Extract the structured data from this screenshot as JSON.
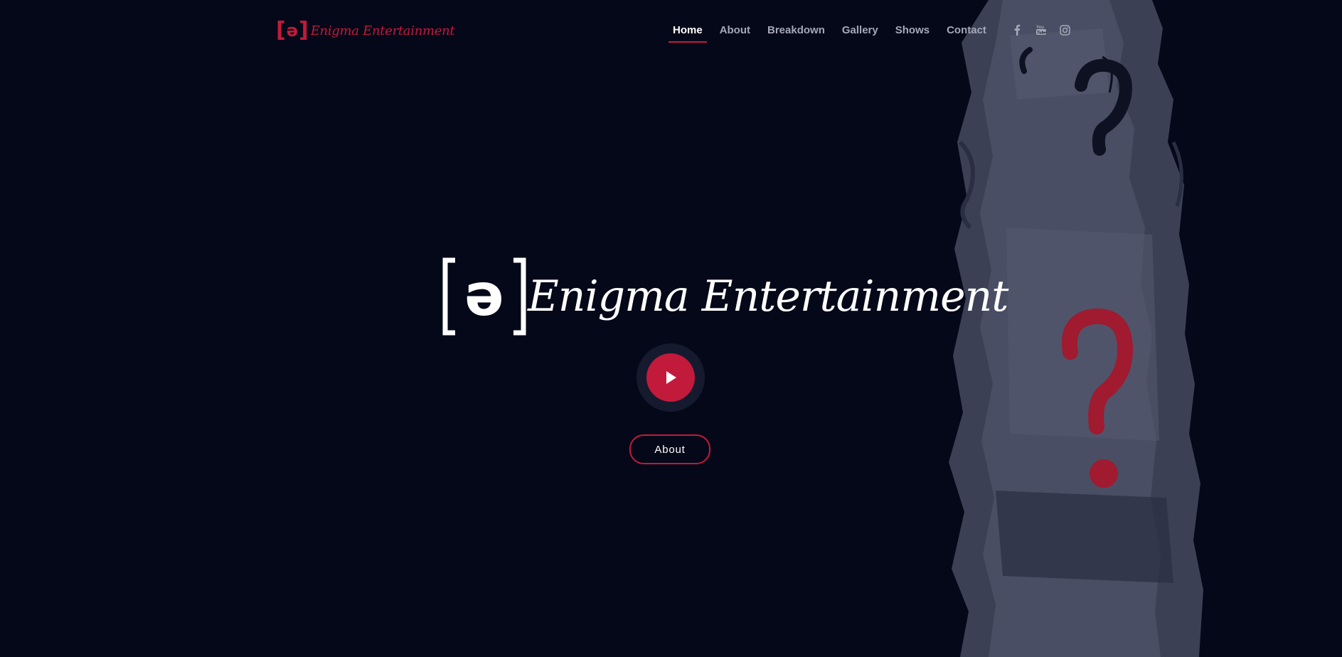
{
  "brand": {
    "name": "Enigma Entertainment",
    "symbol": "ə",
    "accent_color": "#c21a3b",
    "background_color": "#050818"
  },
  "nav": {
    "items": [
      {
        "label": "Home",
        "active": true
      },
      {
        "label": "About",
        "active": false
      },
      {
        "label": "Breakdown",
        "active": false
      },
      {
        "label": "Gallery",
        "active": false
      },
      {
        "label": "Shows",
        "active": false
      },
      {
        "label": "Contact",
        "active": false
      }
    ],
    "social": [
      {
        "icon": "facebook-icon"
      },
      {
        "icon": "youtube-icon"
      },
      {
        "icon": "instagram-icon"
      }
    ]
  },
  "hero": {
    "title": "Enigma Entertainment",
    "symbol": "ə",
    "play_icon": "play-icon",
    "about_button": "About"
  }
}
